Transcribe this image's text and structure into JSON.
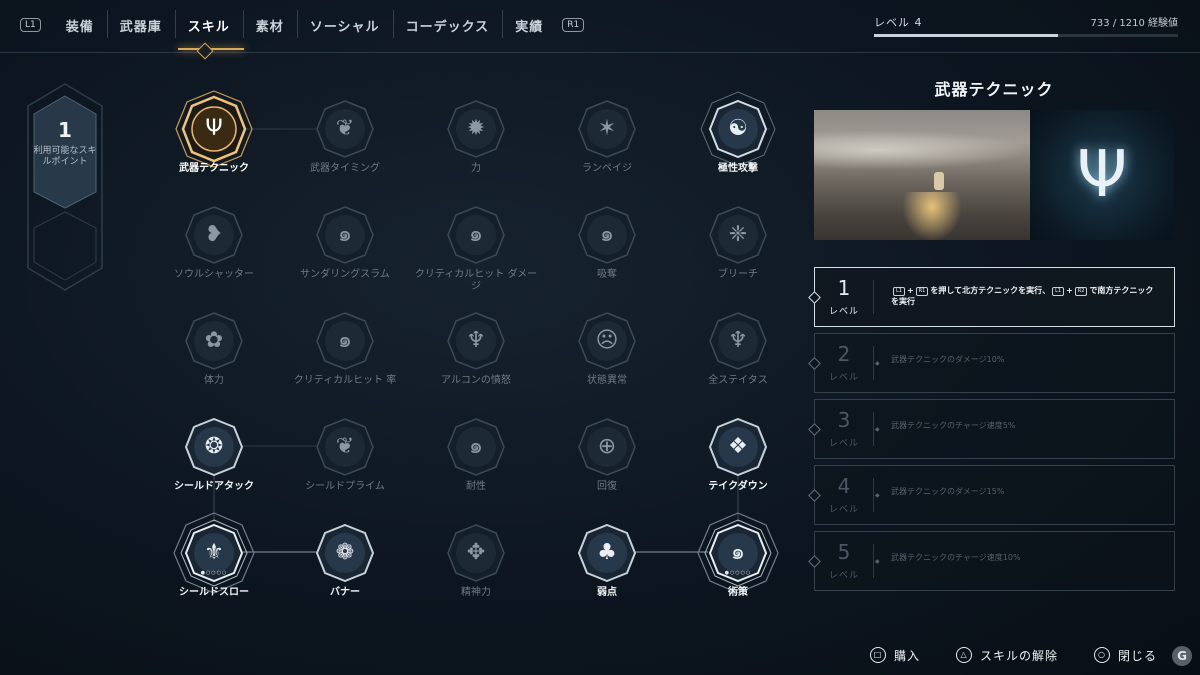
{
  "tabs": {
    "left_hint": "L1",
    "right_hint": "R1",
    "items": [
      {
        "label": "装備"
      },
      {
        "label": "武器庫"
      },
      {
        "label": "スキル"
      },
      {
        "label": "素材"
      },
      {
        "label": "ソーシャル"
      },
      {
        "label": "コーデックス"
      },
      {
        "label": "実績"
      }
    ],
    "active": "スキル"
  },
  "player": {
    "level_label": "レベル 4",
    "xp_text": "733  /  1210 経験値",
    "xp_current": 733,
    "xp_total": 1210
  },
  "skill_points": {
    "value": "1",
    "label": "利用可能なスキルポイント"
  },
  "skills": {
    "r0c0": {
      "label": "武器テクニック",
      "icon": "trident-icon",
      "glyph": "Ψ"
    },
    "r0c1": {
      "label": "武器タイミング",
      "icon": "wing-slash-icon",
      "glyph": "❦"
    },
    "r0c2": {
      "label": "力",
      "icon": "beast-head-icon",
      "glyph": "✹"
    },
    "r0c3": {
      "label": "ランペイジ",
      "icon": "claw-icon",
      "glyph": "✶"
    },
    "r0c4": {
      "label": "極性攻撃",
      "icon": "yin-yang-icon",
      "glyph": "☯"
    },
    "r1c0": {
      "label": "ソウルシャッター",
      "icon": "shattered-heart-icon",
      "glyph": "❥"
    },
    "r1c1": {
      "label": "サンダリングスラム",
      "icon": "swirl-flame-icon",
      "glyph": "๑"
    },
    "r1c2": {
      "label": "クリティカルヒット ダメージ",
      "icon": "crit-swirl-icon",
      "glyph": "๑"
    },
    "r1c3": {
      "label": "吸奪",
      "icon": "leech-flame-icon",
      "glyph": "๑"
    },
    "r1c4": {
      "label": "ブリーチ",
      "icon": "breach-icon",
      "glyph": "❈"
    },
    "r2c0": {
      "label": "体力",
      "icon": "lotus-icon",
      "glyph": "✿"
    },
    "r2c1": {
      "label": "クリティカルヒット 率",
      "icon": "crit-rate-icon",
      "glyph": "๑"
    },
    "r2c2": {
      "label": "アルコンの憤怒",
      "icon": "archon-fury-icon",
      "glyph": "♆"
    },
    "r2c3": {
      "label": "状態異常",
      "icon": "status-mask-icon",
      "glyph": "☹"
    },
    "r2c4": {
      "label": "全ステイタス",
      "icon": "trident-crest-icon",
      "glyph": "♆"
    },
    "r3c0": {
      "label": "シールドアタック",
      "icon": "shield-attack-icon",
      "glyph": "❂"
    },
    "r3c1": {
      "label": "シールドプライム",
      "icon": "shield-prime-icon",
      "glyph": "❦"
    },
    "r3c2": {
      "label": "耐性",
      "icon": "resistance-icon",
      "glyph": "๑"
    },
    "r3c3": {
      "label": "回復",
      "icon": "heal-icon",
      "glyph": "⊕"
    },
    "r3c4": {
      "label": "テイクダウン",
      "icon": "takedown-mask-icon",
      "glyph": "❖"
    },
    "r4c0": {
      "label": "シールドスロー",
      "icon": "shield-throw-icon",
      "glyph": "⚜"
    },
    "r4c1": {
      "label": "バナー",
      "icon": "banner-icon",
      "glyph": "❁"
    },
    "r4c2": {
      "label": "精神力",
      "icon": "spirit-icon",
      "glyph": "✥"
    },
    "r4c3": {
      "label": "弱点",
      "icon": "weak-point-icon",
      "glyph": "♣"
    },
    "r4c4": {
      "label": "術策",
      "icon": "stratagem-flame-icon",
      "glyph": "๑"
    }
  },
  "detail": {
    "title": "武器テクニック",
    "emblem_icon": "trident-emblem-icon",
    "emblem_glyph": "Ψ",
    "levels": [
      {
        "num": "1",
        "word": "レベル",
        "key1": "L1",
        "plus": "+",
        "key2": "R1",
        "text_a": "を押して",
        "text_b": "北方テクニック",
        "text_c": "を実行、",
        "key3": "L1",
        "key4": "R2",
        "text_d": "で",
        "text_e": "南方テクニック",
        "text_f": "を実行"
      },
      {
        "num": "2",
        "word": "レベル",
        "desc": "武器テクニックのダメージ10%"
      },
      {
        "num": "3",
        "word": "レベル",
        "desc": "武器テクニックのチャージ速度5%"
      },
      {
        "num": "4",
        "word": "レベル",
        "desc": "武器テクニックのダメージ15%"
      },
      {
        "num": "5",
        "word": "レベル",
        "desc": "武器テクニックのチャージ速度10%"
      }
    ]
  },
  "prompts": {
    "buy": "購入",
    "unlock": "スキルの解除",
    "close": "閉じる"
  },
  "colors": {
    "accent_gold": "#d9a85a",
    "background": "#0d1620"
  },
  "watermark_text": "G"
}
